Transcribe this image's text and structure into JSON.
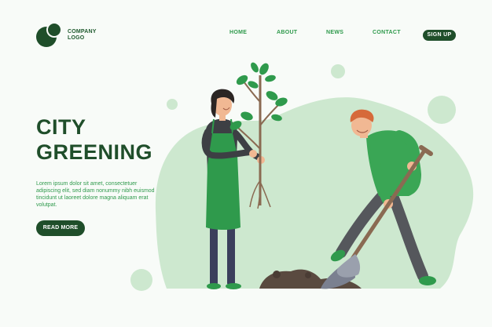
{
  "header": {
    "logo_line1": "COMPANY",
    "logo_line2": "LOGO",
    "nav": [
      "HOME",
      "ABOUT",
      "NEWS",
      "CONTACT"
    ],
    "signup_label": "SIGN UP"
  },
  "hero": {
    "title_line1": "CITY",
    "title_line2": "GREENING",
    "body": "Lorem ipsum dolor sit amet, consectetuer adipiscing elit, sed diam nonummy nibh euismod tincidunt ut laoreet dolore magna aliquam erat volutpat.",
    "cta_label": "READ MORE"
  },
  "colors": {
    "dark_green": "#1f4e2a",
    "accent_green": "#2f9a4c",
    "blob_green": "#cde8cf",
    "shirt_green": "#3aa655"
  }
}
